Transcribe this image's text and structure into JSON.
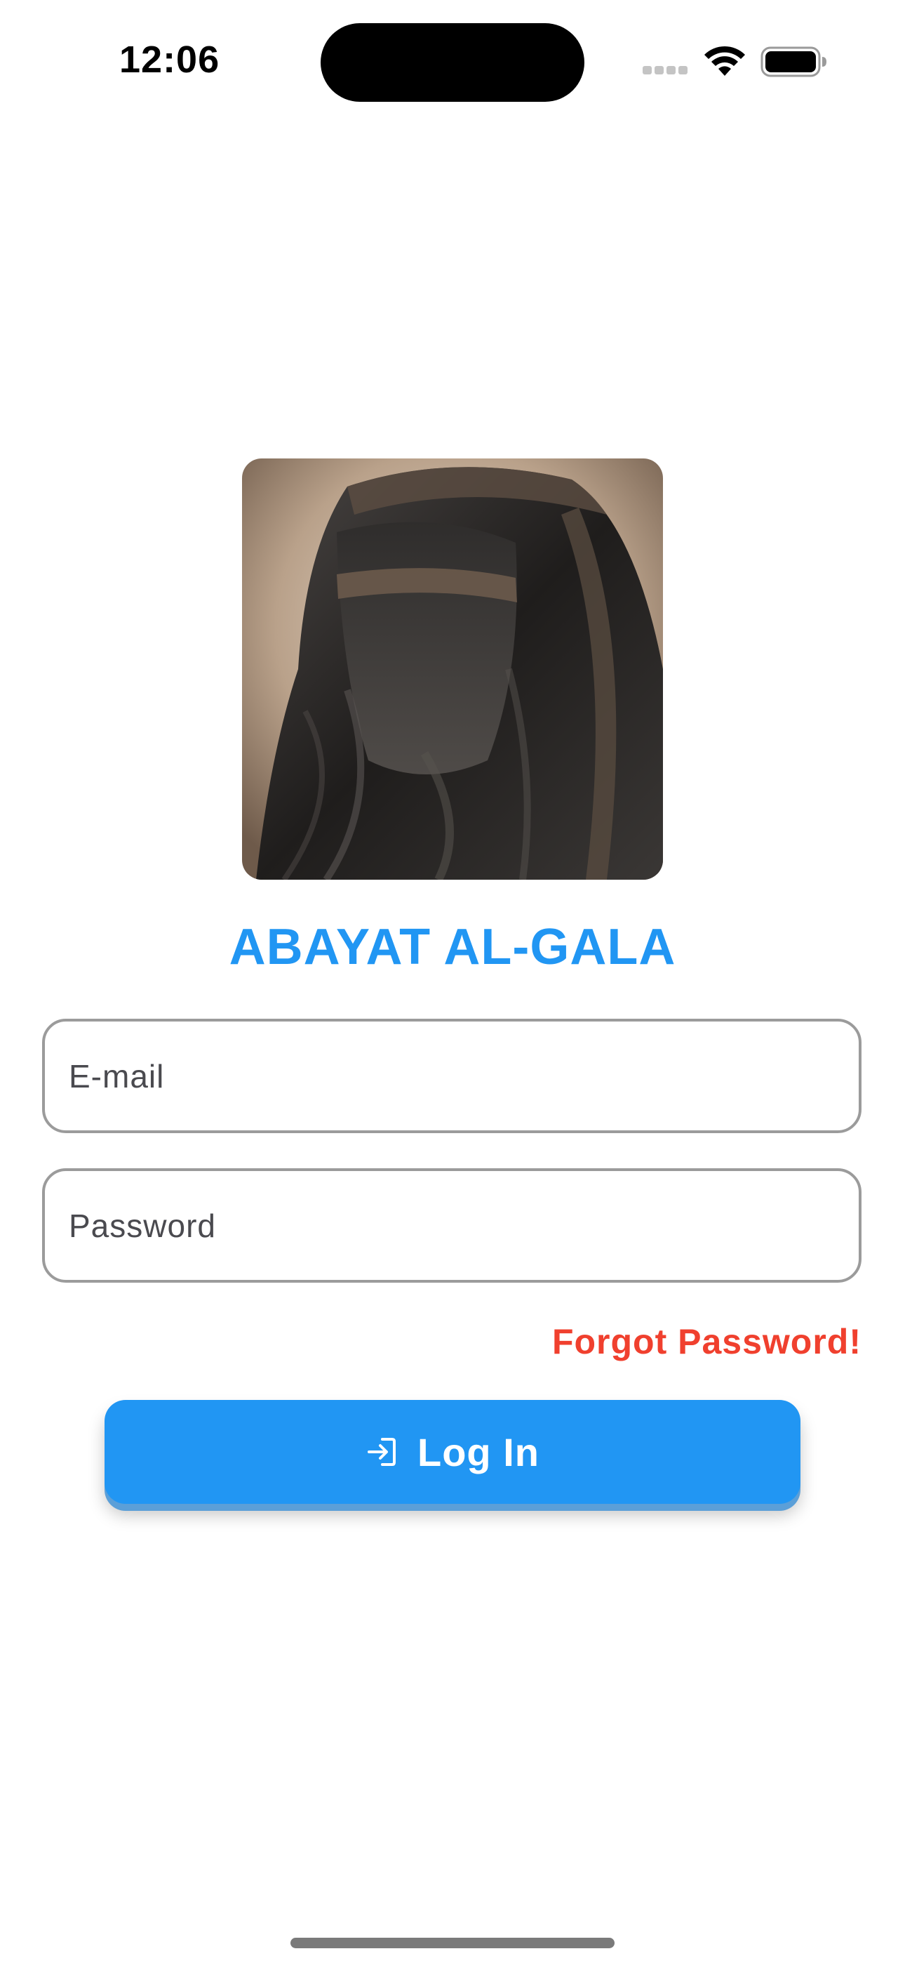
{
  "status_bar": {
    "time": "12:06"
  },
  "app": {
    "title": "ABAYAT AL-GALA",
    "hero_image_icon": "veiled-woman-abaya-photo"
  },
  "login_form": {
    "email_placeholder": "E-mail",
    "email_value": "",
    "password_placeholder": "Password",
    "password_value": "",
    "forgot_label": "Forgot Password!",
    "login_label": "Log In",
    "login_icon": "login-icon"
  },
  "colors": {
    "accent": "#2196f3",
    "danger": "#f0402e",
    "field_border": "#9b9b9b"
  }
}
